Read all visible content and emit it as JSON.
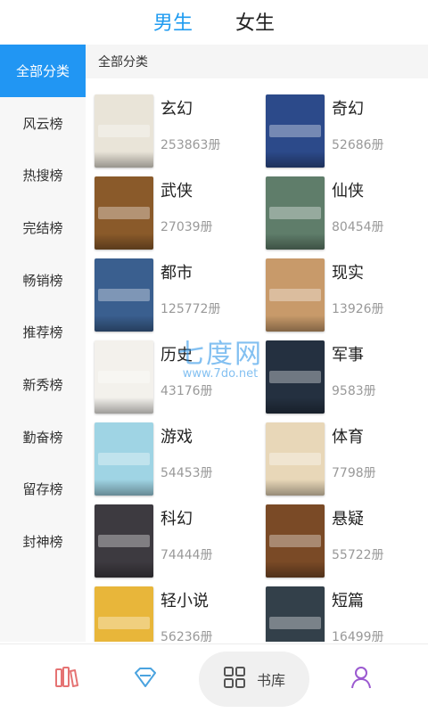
{
  "top_tabs": [
    {
      "label": "男生",
      "active": true
    },
    {
      "label": "女生",
      "active": false
    }
  ],
  "sidebar": {
    "items": [
      {
        "label": "全部分类",
        "active": true
      },
      {
        "label": "风云榜"
      },
      {
        "label": "热搜榜"
      },
      {
        "label": "完结榜"
      },
      {
        "label": "畅销榜"
      },
      {
        "label": "推荐榜"
      },
      {
        "label": "新秀榜"
      },
      {
        "label": "勤奋榜"
      },
      {
        "label": "留存榜"
      },
      {
        "label": "封神榜"
      }
    ]
  },
  "main": {
    "section_title": "全部分类",
    "categories": [
      {
        "name": "玄幻",
        "count": "253863册",
        "cover_color": "#e9e4d8"
      },
      {
        "name": "奇幻",
        "count": "52686册",
        "cover_color": "#2c4a8a"
      },
      {
        "name": "武侠",
        "count": "27039册",
        "cover_color": "#8a5a2a"
      },
      {
        "name": "仙侠",
        "count": "80454册",
        "cover_color": "#5f7d6a"
      },
      {
        "name": "都市",
        "count": "125772册",
        "cover_color": "#3a5f8f"
      },
      {
        "name": "现实",
        "count": "13926册",
        "cover_color": "#c89a6a"
      },
      {
        "name": "历史",
        "count": "43176册",
        "cover_color": "#f3f1ec"
      },
      {
        "name": "军事",
        "count": "9583册",
        "cover_color": "#243040"
      },
      {
        "name": "游戏",
        "count": "54453册",
        "cover_color": "#9fd4e4"
      },
      {
        "name": "体育",
        "count": "7798册",
        "cover_color": "#e8d7b8"
      },
      {
        "name": "科幻",
        "count": "74444册",
        "cover_color": "#3d3a40"
      },
      {
        "name": "悬疑",
        "count": "55722册",
        "cover_color": "#7a4a26"
      },
      {
        "name": "轻小说",
        "count": "56236册",
        "cover_color": "#e8b63a"
      },
      {
        "name": "短篇",
        "count": "16499册",
        "cover_color": "#33404a"
      }
    ]
  },
  "watermark": {
    "title": "七度网",
    "url": "www.7do.net"
  },
  "bottom_nav": {
    "items": [
      {
        "name": "bookshelf",
        "icon": "books-icon",
        "color": "#e57373"
      },
      {
        "name": "discover",
        "icon": "diamond-icon",
        "color": "#4aa3df"
      },
      {
        "name": "library",
        "icon": "grid-icon",
        "label": "书库",
        "color": "#555555"
      },
      {
        "name": "me",
        "icon": "user-icon",
        "color": "#9b59d0"
      }
    ]
  },
  "colors": {
    "accent": "#2196f3",
    "tab_active": "#1e9bf0",
    "count_text": "#999999"
  }
}
